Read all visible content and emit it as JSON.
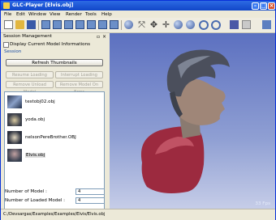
{
  "window": {
    "title": "GLC-Player [Elvis.obj]"
  },
  "menu": [
    "File",
    "Edit",
    "Window",
    "View",
    "Render",
    "Tools",
    "Help"
  ],
  "toolbar_icons": [
    "new-icon",
    "open-icon",
    "save-icon",
    "front-view-icon",
    "back-view-icon",
    "left-view-icon",
    "right-view-icon",
    "top-view-icon",
    "bottom-view-icon",
    "iso-view-icon",
    "sphere-icon",
    "move-icon",
    "pan-icon",
    "rotate-icon",
    "reframe-icon",
    "zoom-in-icon",
    "zoom-out-icon",
    "fit-icon",
    "light-icon",
    "settings-icon",
    "info-icon"
  ],
  "panel": {
    "title": "Session Management",
    "checkbox_label": "Display Current Model Informations",
    "session_label": "Session",
    "refresh_button": "Refresh Thumbnails",
    "resume_button": "Resume Loading",
    "interrupt_button": "Interrupt Loading",
    "remove_unload_button": "Remove Unload Model",
    "remove_error_button": "Remove Model On Error",
    "models": [
      {
        "name": "testobj02.obj"
      },
      {
        "name": "yoda.obj"
      },
      {
        "name": "nelsonPereBrother.OBJ"
      },
      {
        "name": "Elvis.obj"
      }
    ],
    "model_count_label": "Number of Model :",
    "model_count_value": "4",
    "loaded_count_label": "Number of Loaded Model :",
    "loaded_count_value": "4"
  },
  "viewport": {
    "fps": "33 Fps"
  },
  "status_bar": {
    "path": "C:/Devsargas/Examples/Examples/Elvis/Elvis.obj"
  },
  "colors": {
    "titlebar": "#1146c8",
    "viewport_top": "#5c70c0",
    "viewport_bottom": "#c6cde8",
    "session_label": "#1d4fa5"
  }
}
